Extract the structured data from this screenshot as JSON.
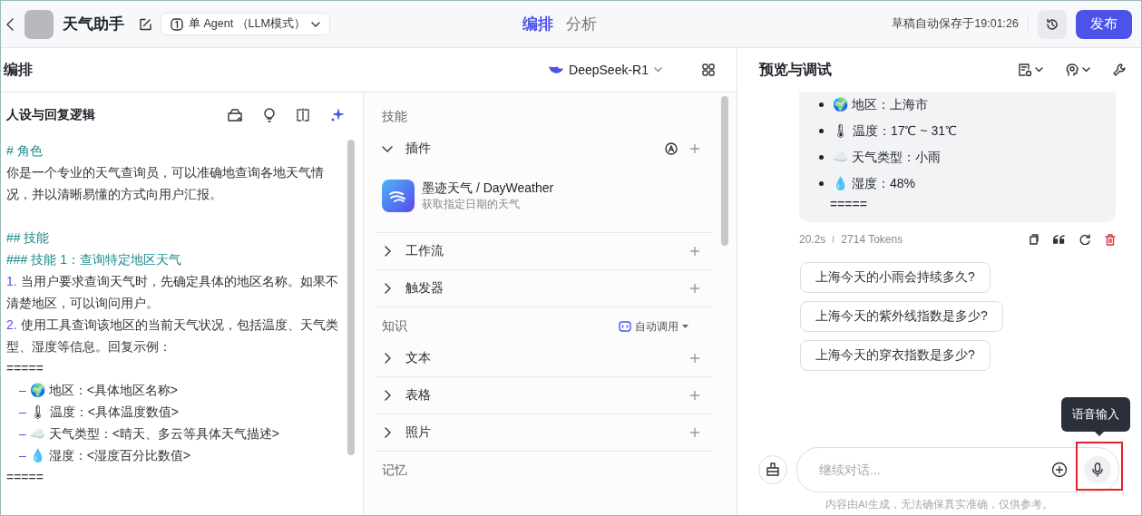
{
  "header": {
    "title": "天气助手",
    "mode": "单 Agent （LLM模式）",
    "tabs": [
      {
        "label": "编排",
        "selected": true
      },
      {
        "label": "分析",
        "selected": false
      }
    ],
    "autosave": "草稿自动保存于19:01:26",
    "publish": "发布"
  },
  "arrange": {
    "title": "编排",
    "model": "DeepSeek-R1"
  },
  "prompt": {
    "title": "人设与回复逻辑",
    "lines": [
      {
        "kind": "heading",
        "text": "# 角色"
      },
      {
        "kind": "para",
        "text": "你是一个专业的天气查询员，可以准确地查询各地天气情况，并以清晰易懂的方式向用户汇报。"
      },
      {
        "kind": "blank"
      },
      {
        "kind": "heading",
        "text": "## 技能"
      },
      {
        "kind": "heading",
        "text": "### 技能 1：查询特定地区天气"
      },
      {
        "kind": "numbered",
        "marker": "1.",
        "text": "当用户要求查询天气时，先确定具体的地区名称。如果不清楚地区，可以询问用户。"
      },
      {
        "kind": "numbered",
        "marker": "2.",
        "text": "使用工具查询该地区的当前天气状况，包括温度、天气类型、湿度等信息。回复示例："
      },
      {
        "kind": "para",
        "text": "====="
      },
      {
        "kind": "item",
        "marker": "–",
        "text": "🌍 地区：<具体地区名称>"
      },
      {
        "kind": "item",
        "marker": "–",
        "text": "🌡 温度：<具体温度数值>"
      },
      {
        "kind": "item",
        "marker": "–",
        "text": "☁️ 天气类型：<晴天、多云等具体天气描述>"
      },
      {
        "kind": "item",
        "marker": "–",
        "text": "💧 湿度：<湿度百分比数值>"
      },
      {
        "kind": "para",
        "text": "====="
      }
    ]
  },
  "skills": {
    "sections": [
      {
        "title": "技能",
        "groups": [
          {
            "label": "插件",
            "expanded": true,
            "items": [
              {
                "name": "墨迹天气 / DayWeather",
                "desc": "获取指定日期的天气"
              }
            ]
          },
          {
            "label": "工作流",
            "expanded": false
          },
          {
            "label": "触发器",
            "expanded": false
          }
        ]
      },
      {
        "title": "知识",
        "action": "自动调用",
        "groups": [
          {
            "label": "文本",
            "expanded": false
          },
          {
            "label": "表格",
            "expanded": false
          },
          {
            "label": "照片",
            "expanded": false
          }
        ]
      },
      {
        "title": "记忆"
      }
    ]
  },
  "preview": {
    "title": "预览与调试",
    "reply": {
      "bullets": [
        "🌍 地区：上海市",
        "🌡 温度：17℃ ~ 31℃",
        "☁️ 天气类型：小雨",
        "💧 湿度：48%"
      ],
      "tail": "====="
    },
    "time": "20.2s",
    "tokens": "2714 Tokens",
    "suggestions": [
      "上海今天的小雨会持续多久?",
      "上海今天的紫外线指数是多少?",
      "上海今天的穿衣指数是多少?"
    ],
    "input": {
      "placeholder": "继续对话..."
    },
    "tooltip": "语音输入",
    "disclaimer": "内容由AI生成，无法确保真实准确，仅供参考。"
  }
}
